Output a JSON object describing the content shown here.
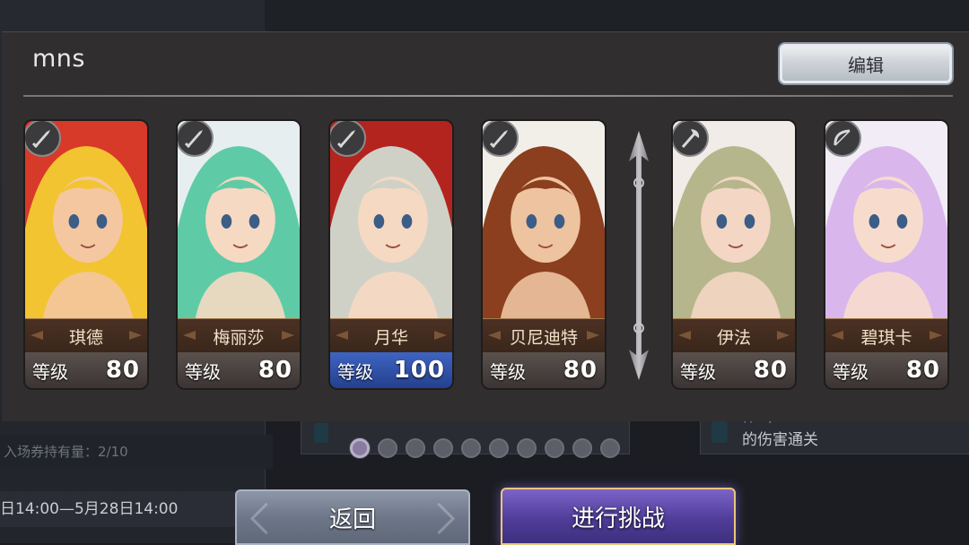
{
  "background": {
    "ticket_text": "入场券持有量：2/10",
    "date_text": "日14:00—5月28日14:00",
    "right_card_line1": "神...,... ...",
    "right_card_line2": "的伤害通关"
  },
  "dialog": {
    "team_name": "mns",
    "edit_label": "编辑"
  },
  "cards": [
    {
      "name": "琪德",
      "level_label": "等级",
      "level": "80",
      "weapon_icon": "sword-icon",
      "hair": "#f2c431",
      "skin": "#f4c7a0",
      "bg": "#d83a2a",
      "bar": "brown"
    },
    {
      "name": "梅丽莎",
      "level_label": "等级",
      "level": "80",
      "weapon_icon": "sword-icon",
      "hair": "#5fcba6",
      "skin": "#f6d9c3",
      "bg": "#e6eef0",
      "bar": "brown"
    },
    {
      "name": "月华",
      "level_label": "等级",
      "level": "100",
      "weapon_icon": "sword-icon",
      "hair": "#cfd1c7",
      "skin": "#f6d9c3",
      "bg": "#b3241f",
      "bar": "blue"
    },
    {
      "name": "贝尼迪特",
      "level_label": "等级",
      "level": "80",
      "weapon_icon": "sword-icon",
      "hair": "#8b3f1e",
      "skin": "#eec3a0",
      "bg": "#f2efe9",
      "bar": "brown"
    },
    {
      "name": "伊法",
      "level_label": "等级",
      "level": "80",
      "weapon_icon": "axe-icon",
      "hair": "#b5b68b",
      "skin": "#f4d6c4",
      "bg": "#f1ece8",
      "bar": "brown"
    },
    {
      "name": "碧琪卡",
      "level_label": "等级",
      "level": "80",
      "weapon_icon": "bow-icon",
      "hair": "#d9b7ec",
      "skin": "#f7dccd",
      "bg": "#f2ecf6",
      "bar": "brown"
    }
  ],
  "pagination": {
    "total": 10,
    "active": 0
  },
  "buttons": {
    "back_label": "返回",
    "challenge_label": "进行挑战"
  }
}
